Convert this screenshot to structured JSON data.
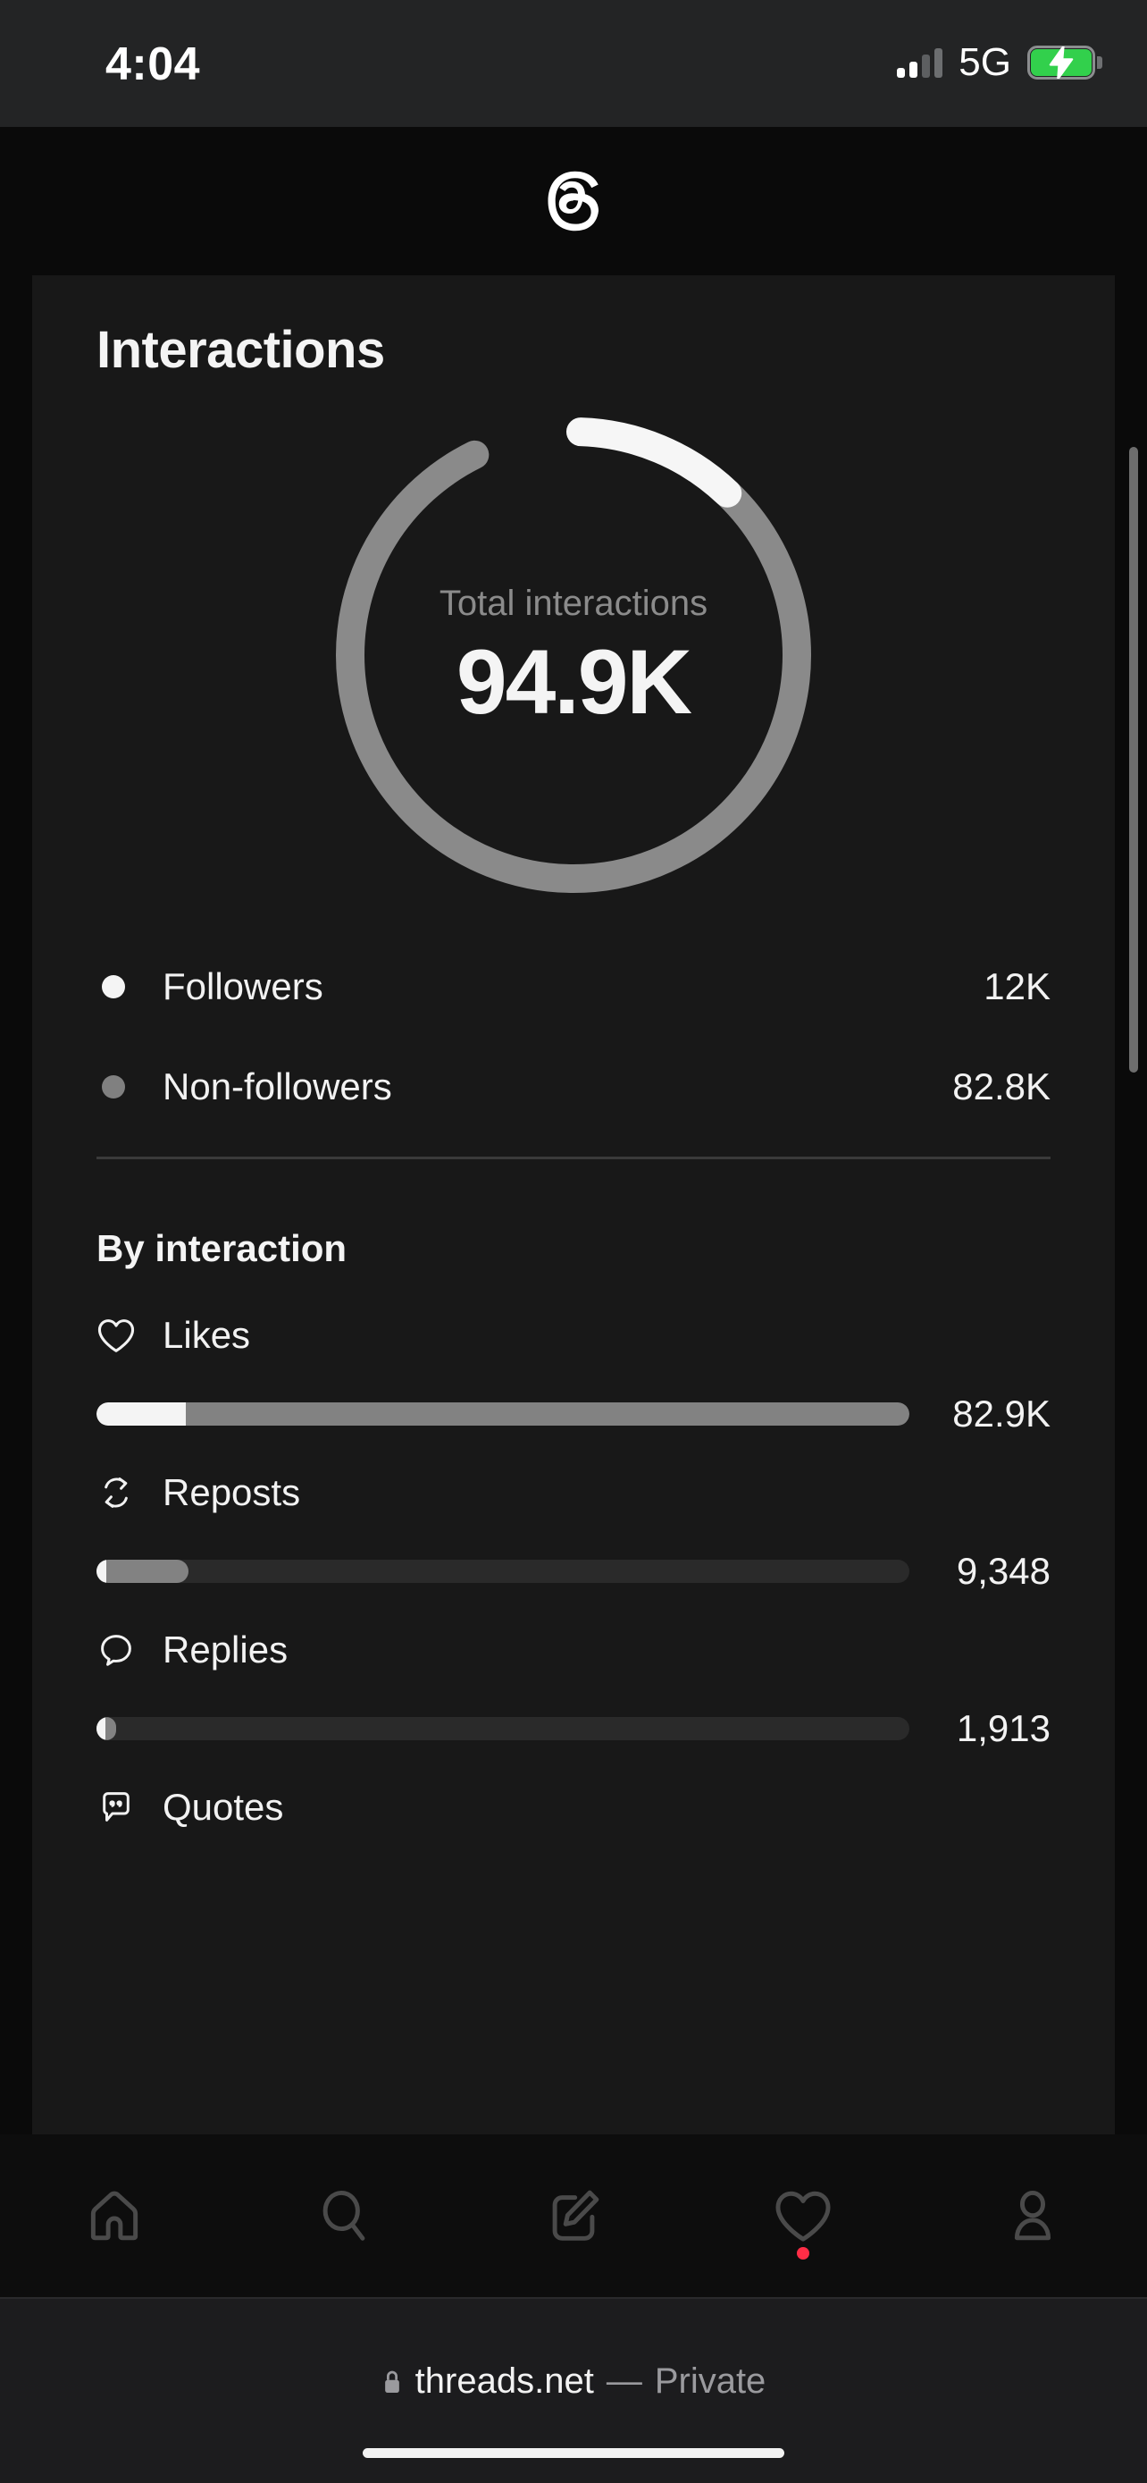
{
  "status_bar": {
    "time": "4:04",
    "network": "5G",
    "signal_bars_active": 2,
    "signal_bars_total": 4,
    "battery_charging": true,
    "battery_color": "#32d04c"
  },
  "header": {
    "logo_icon": "threads-logo-icon",
    "menu_icon": "hamburger-menu-icon"
  },
  "insights": {
    "title": "Interactions",
    "donut": {
      "center_label": "Total interactions",
      "center_value": "94.9K",
      "followers_percent": 12.6,
      "followers_color": "#f4f4f4",
      "nonfollowers_color": "#8a8a8a"
    },
    "legend": [
      {
        "label": "Followers",
        "value": "12K",
        "color": "#f4f4f4"
      },
      {
        "label": "Non-followers",
        "value": "82.8K",
        "color": "#808080"
      }
    ],
    "by_interaction": {
      "heading": "By interaction",
      "rows": [
        {
          "icon": "heart-icon",
          "label": "Likes",
          "value": "82.9K",
          "white_percent": 11.0,
          "grey_percent": 100.0
        },
        {
          "icon": "repost-icon",
          "label": "Reposts",
          "value": "9,348",
          "white_percent": 1.2,
          "grey_percent": 11.3
        },
        {
          "icon": "reply-icon",
          "label": "Replies",
          "value": "1,913",
          "white_percent": 1.1,
          "grey_percent": 2.3
        },
        {
          "icon": "quote-icon",
          "label": "Quotes",
          "value": "",
          "white_percent": 0,
          "grey_percent": 0
        }
      ]
    }
  },
  "chart_data": {
    "type": "pie",
    "title": "Total interactions",
    "total": 94900,
    "total_label": "94.9K",
    "categories": [
      "Followers",
      "Non-followers"
    ],
    "values": [
      12000,
      82800
    ],
    "value_labels": [
      "12K",
      "82.8K"
    ],
    "colors": [
      "#f4f4f4",
      "#8a8a8a"
    ],
    "legend": "below",
    "secondary": {
      "type": "bar",
      "title": "By interaction",
      "orientation": "horizontal",
      "categories": [
        "Likes",
        "Reposts",
        "Replies",
        "Quotes"
      ],
      "values": [
        82900,
        9348,
        1913,
        null
      ],
      "value_labels": [
        "82.9K",
        "9,348",
        "1,913",
        ""
      ],
      "series": [
        {
          "name": "Followers",
          "color": "#f4f4f4",
          "values": [
            9100,
            1120,
            210,
            null
          ]
        },
        {
          "name": "Non-followers",
          "color": "#828282",
          "values": [
            73800,
            8228,
            1703,
            null
          ]
        }
      ],
      "grid": false
    }
  },
  "tabbar": {
    "items": [
      {
        "name": "home-icon",
        "label": "Home",
        "badge": false
      },
      {
        "name": "search-icon",
        "label": "Search",
        "badge": false
      },
      {
        "name": "compose-icon",
        "label": "Compose",
        "badge": false
      },
      {
        "name": "heart-icon",
        "label": "Activity",
        "badge": true
      },
      {
        "name": "profile-icon",
        "label": "Profile",
        "badge": false
      }
    ],
    "badge_color": "#ff2d46"
  },
  "browser": {
    "lock_icon": "lock-icon",
    "host": "threads.net",
    "separator": "—",
    "mode": "Private"
  }
}
